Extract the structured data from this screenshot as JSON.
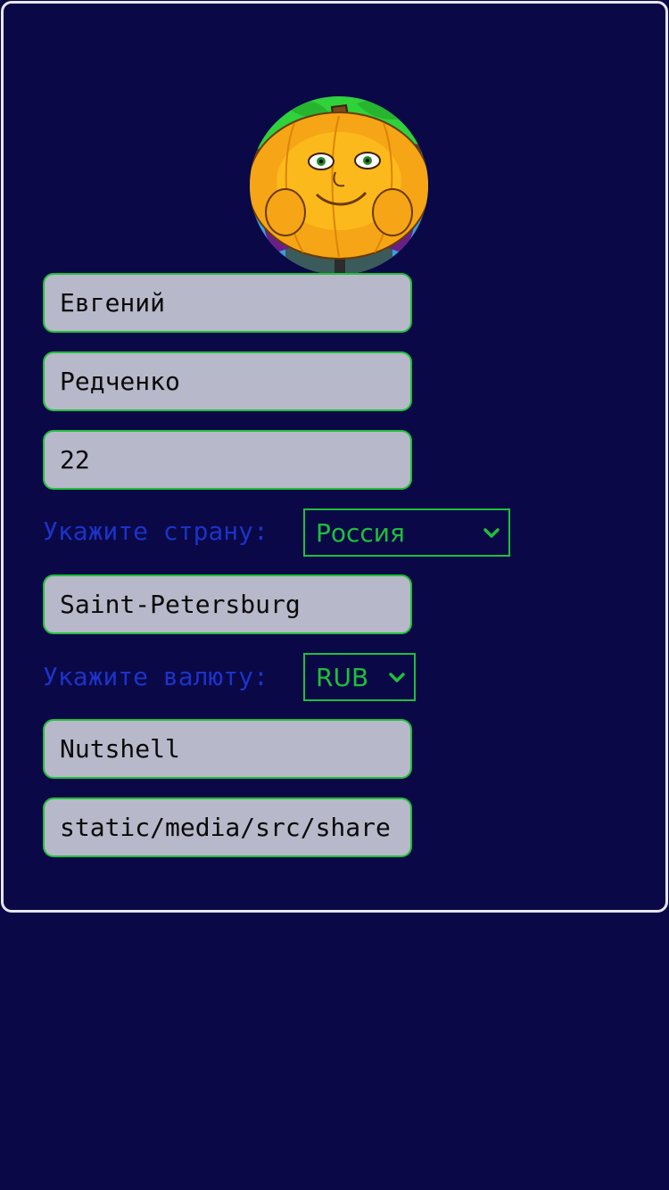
{
  "profile": {
    "first_name": "Евгений",
    "last_name": "Редченко",
    "age": "22",
    "country_label": "Укажите страну:",
    "country_selected": "Россия",
    "city": "Saint-Petersburg",
    "currency_label": "Укажите валюту:",
    "currency_selected": "RUB",
    "nickname": "Nutshell",
    "avatar_path": "static/media/src/share"
  },
  "icons": {
    "avatar": "pumpkin-character-avatar",
    "dropdown": "chevron-down-icon"
  },
  "colors": {
    "background": "#0a0847",
    "card_border": "#e6e6ee",
    "field_bg": "#b7b8c9",
    "accent_green": "#1fbf3a",
    "label_blue": "#1b33c8"
  }
}
